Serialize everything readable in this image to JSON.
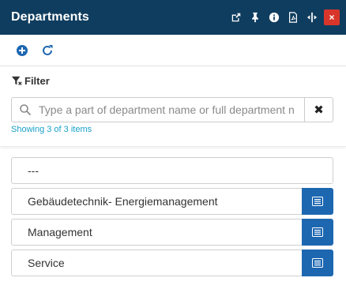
{
  "window": {
    "title": "Departments",
    "icons": [
      "popout-icon",
      "pin-icon",
      "info-icon",
      "pdf-icon",
      "resize-icon"
    ],
    "close_label": "×"
  },
  "toolbar": {
    "buttons": [
      "add-icon",
      "refresh-icon"
    ]
  },
  "filter": {
    "heading": "Filter",
    "search_placeholder": "Type a part of department name or full department n",
    "search_value": "",
    "clear_label": "✖",
    "showing_text": "Showing 3 of 3 items"
  },
  "list": {
    "items": [
      {
        "label": "---",
        "has_button": false
      },
      {
        "label": "Gebäudetechnik- Energiemanagement",
        "has_button": true
      },
      {
        "label": "Management",
        "has_button": true
      },
      {
        "label": "Service",
        "has_button": true
      }
    ]
  },
  "colors": {
    "titlebar_bg": "#0f3d5f",
    "close_bg": "#d9362b",
    "accent_blue": "#1d67b1",
    "showing_text": "#1aa1c9"
  }
}
